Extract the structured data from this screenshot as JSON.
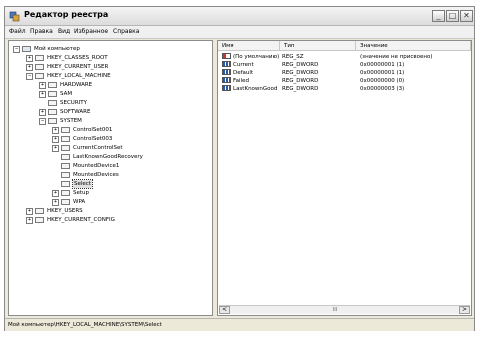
{
  "window": {
    "title": "Редактор реестра",
    "controls": {
      "minimize": "_",
      "maximize": "□",
      "close": "✕"
    }
  },
  "menu": [
    "Файл",
    "Правка",
    "Вид",
    "Избранное",
    "Справка"
  ],
  "tree": [
    {
      "label": "Мой компьютер",
      "depth": 0,
      "expander": "−",
      "icon": "computer-icon"
    },
    {
      "label": "HKEY_CLASSES_ROOT",
      "depth": 1,
      "expander": "+",
      "icon": "folder-icon"
    },
    {
      "label": "HKEY_CURRENT_USER",
      "depth": 1,
      "expander": "+",
      "icon": "folder-icon"
    },
    {
      "label": "HKEY_LOCAL_MACHINE",
      "depth": 1,
      "expander": "−",
      "icon": "folder-icon"
    },
    {
      "label": "HARDWARE",
      "depth": 2,
      "expander": "+",
      "icon": "folder-icon"
    },
    {
      "label": "SAM",
      "depth": 2,
      "expander": "+",
      "icon": "folder-icon"
    },
    {
      "label": "SECURITY",
      "depth": 2,
      "expander": "",
      "icon": "folder-icon"
    },
    {
      "label": "SOFTWARE",
      "depth": 2,
      "expander": "+",
      "icon": "folder-icon"
    },
    {
      "label": "SYSTEM",
      "depth": 2,
      "expander": "−",
      "icon": "folder-icon"
    },
    {
      "label": "ControlSet001",
      "depth": 3,
      "expander": "+",
      "icon": "folder-icon"
    },
    {
      "label": "ControlSet003",
      "depth": 3,
      "expander": "+",
      "icon": "folder-icon"
    },
    {
      "label": "CurrentControlSet",
      "depth": 3,
      "expander": "+",
      "icon": "folder-icon"
    },
    {
      "label": "LastKnownGoodRecovery",
      "depth": 3,
      "expander": "",
      "icon": "folder-icon"
    },
    {
      "label": "MountedDevice1",
      "depth": 3,
      "expander": "",
      "icon": "folder-icon"
    },
    {
      "label": "MountedDevices",
      "depth": 3,
      "expander": "",
      "icon": "folder-icon"
    },
    {
      "label": "Select",
      "depth": 3,
      "expander": "",
      "icon": "folder-open-icon",
      "selected": true
    },
    {
      "label": "Setup",
      "depth": 3,
      "expander": "+",
      "icon": "folder-icon"
    },
    {
      "label": "WPA",
      "depth": 3,
      "expander": "+",
      "icon": "folder-icon"
    },
    {
      "label": "HKEY_USERS",
      "depth": 1,
      "expander": "+",
      "icon": "folder-icon"
    },
    {
      "label": "HKEY_CURRENT_CONFIG",
      "depth": 1,
      "expander": "+",
      "icon": "folder-icon"
    }
  ],
  "list": {
    "columns": [
      "Имя",
      "Тип",
      "Значение"
    ],
    "rows": [
      {
        "name": "(По умолчанию)",
        "type": "REG_SZ",
        "value": "(значение не присвоено)",
        "icon": "string-value-icon"
      },
      {
        "name": "Current",
        "type": "REG_DWORD",
        "value": "0x00000001 (1)",
        "icon": "dword-value-icon"
      },
      {
        "name": "Default",
        "type": "REG_DWORD",
        "value": "0x00000001 (1)",
        "icon": "dword-value-icon"
      },
      {
        "name": "Failed",
        "type": "REG_DWORD",
        "value": "0x00000000 (0)",
        "icon": "dword-value-icon"
      },
      {
        "name": "LastKnownGood",
        "type": "REG_DWORD",
        "value": "0x00000003 (3)",
        "icon": "dword-value-icon"
      }
    ]
  },
  "scrollbar": {
    "left": "<",
    "right": ">",
    "grip": "III"
  },
  "status": "Мой компьютер\\HKEY_LOCAL_MACHINE\\SYSTEM\\Select"
}
